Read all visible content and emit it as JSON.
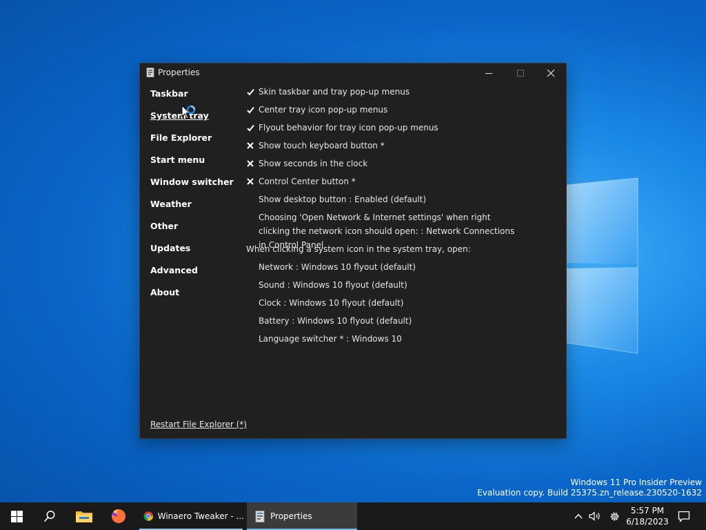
{
  "window": {
    "title": "Properties",
    "controls": {
      "minimize": "minimize",
      "maximize": "maximize",
      "close": "close"
    }
  },
  "sidebar": {
    "active_index": 1,
    "items": [
      {
        "label": "Taskbar"
      },
      {
        "label": "System tray"
      },
      {
        "label": "File Explorer"
      },
      {
        "label": "Start menu"
      },
      {
        "label": "Window switcher"
      },
      {
        "label": "Weather"
      },
      {
        "label": "Other"
      },
      {
        "label": "Updates"
      },
      {
        "label": "Advanced"
      },
      {
        "label": "About"
      }
    ]
  },
  "settings": {
    "options": [
      {
        "mark": "check",
        "label": "Skin taskbar and tray pop-up menus"
      },
      {
        "mark": "check",
        "label": "Center tray icon pop-up menus"
      },
      {
        "mark": "check",
        "label": "Flyout behavior for tray icon pop-up menus"
      },
      {
        "mark": "cross",
        "label": "Show touch keyboard button *"
      },
      {
        "mark": "cross",
        "label": "Show seconds in the clock"
      },
      {
        "mark": "cross",
        "label": "Control Center button *"
      }
    ],
    "show_desktop": "Show desktop button : Enabled (default)",
    "network_context": "Choosing 'Open Network & Internet settings' when right clicking the network icon should open: : Network Connections in Control Panel",
    "system_icon_heading": "When clicking a system icon in the system tray, open:",
    "system_icons": [
      "Network : Windows 10 flyout (default)",
      "Sound : Windows 10 flyout (default)",
      "Clock : Windows 10 flyout (default)",
      "Battery : Windows 10 flyout (default)",
      "Language switcher * : Windows 10"
    ]
  },
  "footer": {
    "restart_link": "Restart File Explorer (*)"
  },
  "watermark": {
    "line1": "Windows 11 Pro Insider Preview",
    "line2": "Evaluation copy. Build 25375.zn_release.230520-1632"
  },
  "taskbar": {
    "chrome_label": "Winaero Tweaker - ...",
    "properties_label": "Properties",
    "clock_time": "5:57 PM",
    "clock_date": "6/18/2023"
  },
  "colors": {
    "window_bg": "#202020",
    "taskbar_bg": "#1a1a1a",
    "accent": "#76b9ed",
    "desktop": "#0a66c8"
  }
}
